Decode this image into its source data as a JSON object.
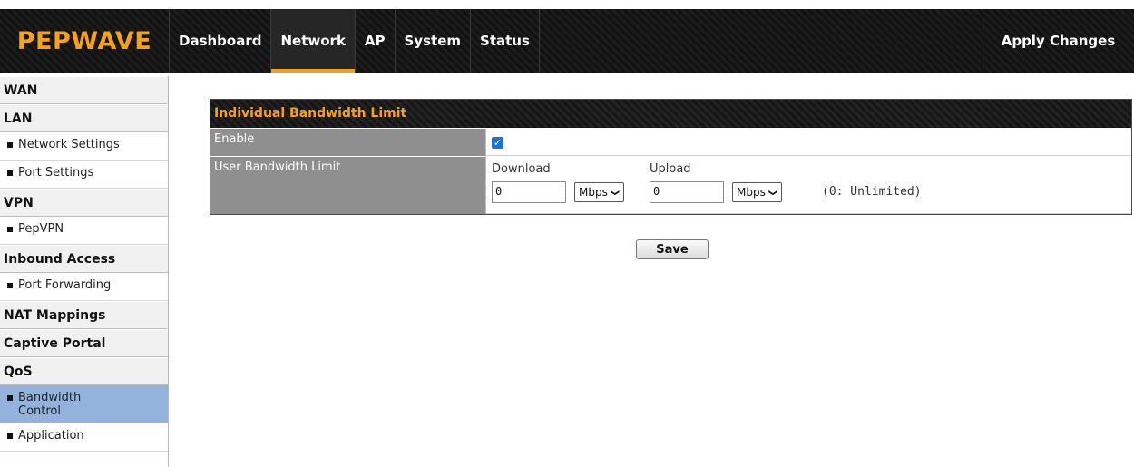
{
  "brand": {
    "logo_text": "PEPWAVE",
    "accent_color": "#f5a21a"
  },
  "nav": {
    "items": [
      {
        "label": "Dashboard",
        "active": false
      },
      {
        "label": "Network",
        "active": true
      },
      {
        "label": "AP",
        "active": false
      },
      {
        "label": "System",
        "active": false
      },
      {
        "label": "Status",
        "active": false
      }
    ],
    "apply_label": "Apply Changes"
  },
  "sidebar": {
    "sections": [
      {
        "label": "WAN",
        "items": []
      },
      {
        "label": "LAN",
        "items": [
          "Network Settings",
          "Port Settings"
        ]
      },
      {
        "label": "VPN",
        "items": [
          "PepVPN"
        ]
      },
      {
        "label": "Inbound Access",
        "items": [
          "Port Forwarding"
        ]
      },
      {
        "label": "NAT Mappings",
        "items": []
      },
      {
        "label": "Captive Portal",
        "items": []
      },
      {
        "label": "QoS",
        "items": [
          "Bandwidth Control",
          "Application"
        ]
      }
    ],
    "active_item": "Bandwidth Control",
    "active_color": "#93b3dc"
  },
  "panel": {
    "title": "Individual Bandwidth Limit",
    "enable_label": "Enable",
    "enable_checked": true,
    "limit_label": "User Bandwidth Limit",
    "download_label": "Download",
    "upload_label": "Upload",
    "download_value": "0",
    "download_unit": "Mbps",
    "upload_value": "0",
    "upload_unit": "Mbps",
    "hint": "(0: Unlimited)"
  },
  "actions": {
    "save_label": "Save"
  }
}
